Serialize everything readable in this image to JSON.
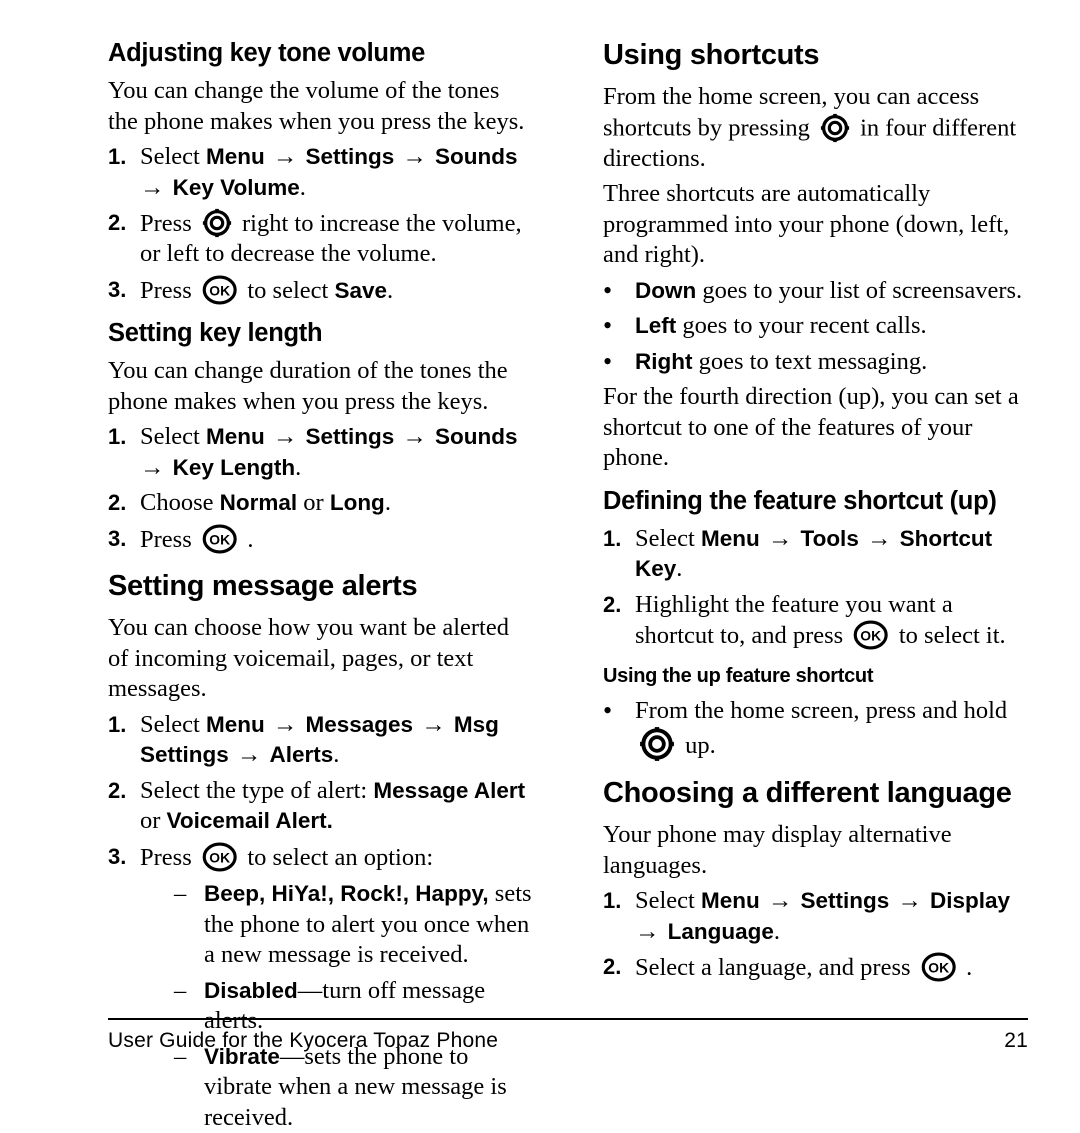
{
  "document": {
    "title": "User Guide for the Kyocera Topaz Phone",
    "page_number": "21"
  },
  "icons": {
    "nav_key": "navigation-key-icon",
    "ok_key": "ok-key-icon",
    "ok_label": "OK"
  },
  "arrow": "→",
  "bullet": "•",
  "dash": "–",
  "left_column": {
    "section1": {
      "heading": "Adjusting key tone volume",
      "intro": "You can change the volume of the tones the phone makes when you press the keys.",
      "steps": [
        {
          "marker": "1.",
          "parts": [
            {
              "t": "Select ",
              "s": "normal"
            },
            {
              "t": "Menu",
              "s": "bold"
            },
            {
              "t": " → ",
              "s": "arrow"
            },
            {
              "t": "Settings",
              "s": "bold"
            },
            {
              "t": " → ",
              "s": "arrow"
            },
            {
              "t": "Sounds",
              "s": "bold"
            },
            {
              "t": " → ",
              "s": "arrow"
            },
            {
              "t": "Key Volume",
              "s": "bold"
            },
            {
              "t": ".",
              "s": "normal"
            }
          ]
        },
        {
          "marker": "2.",
          "parts": [
            {
              "t": "Press ",
              "s": "normal"
            },
            {
              "t": "",
              "s": "nav-key"
            },
            {
              "t": " right to increase the volume, or left to decrease the volume.",
              "s": "normal"
            }
          ]
        },
        {
          "marker": "3.",
          "parts": [
            {
              "t": "Press ",
              "s": "normal"
            },
            {
              "t": "",
              "s": "ok-key"
            },
            {
              "t": " to select ",
              "s": "normal"
            },
            {
              "t": "Save",
              "s": "bold"
            },
            {
              "t": ".",
              "s": "normal"
            }
          ]
        }
      ]
    },
    "section2": {
      "heading": "Setting key length",
      "intro": "You can change duration of the tones the phone makes when you press the keys.",
      "steps": [
        {
          "marker": "1.",
          "parts": [
            {
              "t": "Select ",
              "s": "normal"
            },
            {
              "t": "Menu",
              "s": "bold"
            },
            {
              "t": " → ",
              "s": "arrow"
            },
            {
              "t": "Settings",
              "s": "bold"
            },
            {
              "t": " → ",
              "s": "arrow"
            },
            {
              "t": "Sounds",
              "s": "bold"
            },
            {
              "t": " → ",
              "s": "arrow"
            },
            {
              "t": "Key Length",
              "s": "bold"
            },
            {
              "t": ".",
              "s": "normal"
            }
          ]
        },
        {
          "marker": "2.",
          "parts": [
            {
              "t": "Choose ",
              "s": "normal"
            },
            {
              "t": "Normal",
              "s": "bold"
            },
            {
              "t": " or ",
              "s": "normal"
            },
            {
              "t": "Long",
              "s": "bold"
            },
            {
              "t": ".",
              "s": "normal"
            }
          ]
        },
        {
          "marker": "3.",
          "parts": [
            {
              "t": "Press ",
              "s": "normal"
            },
            {
              "t": "",
              "s": "ok-key"
            },
            {
              "t": " .",
              "s": "normal"
            }
          ]
        }
      ]
    },
    "section3": {
      "heading": "Setting message alerts",
      "intro": "You can choose how you want be alerted of incoming voicemail, pages, or text messages.",
      "steps": [
        {
          "marker": "1.",
          "parts": [
            {
              "t": "Select ",
              "s": "normal"
            },
            {
              "t": "Menu",
              "s": "bold"
            },
            {
              "t": " → ",
              "s": "arrow"
            },
            {
              "t": "Messages",
              "s": "bold"
            },
            {
              "t": " → ",
              "s": "arrow"
            },
            {
              "t": "Msg Settings",
              "s": "bold"
            },
            {
              "t": " → ",
              "s": "arrow"
            },
            {
              "t": "Alerts",
              "s": "bold"
            },
            {
              "t": ".",
              "s": "normal"
            }
          ]
        },
        {
          "marker": "2.",
          "parts": [
            {
              "t": "Select the type of alert: ",
              "s": "normal"
            },
            {
              "t": "Message Alert",
              "s": "bold"
            },
            {
              "t": " or ",
              "s": "normal"
            },
            {
              "t": "Voicemail Alert.",
              "s": "bold"
            }
          ]
        },
        {
          "marker": "3.",
          "parts": [
            {
              "t": "Press ",
              "s": "normal"
            },
            {
              "t": "",
              "s": "ok-key"
            },
            {
              "t": " to select an option:",
              "s": "normal"
            }
          ],
          "sublist": [
            {
              "marker": "–",
              "parts": [
                {
                  "t": "Beep, HiYa!, Rock!, Happy,",
                  "s": "bold"
                },
                {
                  "t": " sets the phone to alert you once when a new message is received.",
                  "s": "normal"
                }
              ]
            },
            {
              "marker": "–",
              "parts": [
                {
                  "t": "Disabled",
                  "s": "bold"
                },
                {
                  "t": "—turn off message alerts.",
                  "s": "normal"
                }
              ]
            },
            {
              "marker": "–",
              "parts": [
                {
                  "t": "Vibrate",
                  "s": "bold"
                },
                {
                  "t": "—sets the phone to vibrate when a new message is received.",
                  "s": "normal"
                }
              ]
            }
          ]
        }
      ]
    }
  },
  "right_column": {
    "section1": {
      "heading": "Using shortcuts",
      "paragraphs": [
        [
          {
            "t": "From the home screen, you can access shortcuts by pressing ",
            "s": "normal"
          },
          {
            "t": "",
            "s": "nav-key"
          },
          {
            "t": " in four different directions.",
            "s": "normal"
          }
        ],
        [
          {
            "t": "Three shortcuts are automatically programmed into your phone (down, left, and right).",
            "s": "normal"
          }
        ]
      ],
      "bullets": [
        {
          "marker": "•",
          "parts": [
            {
              "t": "Down",
              "s": "bold"
            },
            {
              "t": " goes to your list of screensavers.",
              "s": "normal"
            }
          ]
        },
        {
          "marker": "•",
          "parts": [
            {
              "t": "Left",
              "s": "bold"
            },
            {
              "t": " goes to your recent calls.",
              "s": "normal"
            }
          ]
        },
        {
          "marker": "•",
          "parts": [
            {
              "t": "Right",
              "s": "bold"
            },
            {
              "t": " goes to text messaging.",
              "s": "normal"
            }
          ]
        }
      ],
      "closing": "For the fourth direction (up), you can set a shortcut to one of the features of your phone."
    },
    "section2": {
      "heading": "Defining the feature shortcut (up)",
      "steps": [
        {
          "marker": "1.",
          "parts": [
            {
              "t": "Select ",
              "s": "normal"
            },
            {
              "t": "Menu",
              "s": "bold"
            },
            {
              "t": " → ",
              "s": "arrow"
            },
            {
              "t": "Tools",
              "s": "bold"
            },
            {
              "t": " → ",
              "s": "arrow"
            },
            {
              "t": "Shortcut Key",
              "s": "bold"
            },
            {
              "t": ".",
              "s": "normal"
            }
          ]
        },
        {
          "marker": "2.",
          "parts": [
            {
              "t": "Highlight the feature you want a shortcut to, and press ",
              "s": "normal"
            },
            {
              "t": "",
              "s": "ok-key"
            },
            {
              "t": " to select it.",
              "s": "normal"
            }
          ]
        }
      ],
      "subheading": "Using the up feature shortcut",
      "subbullets": [
        {
          "marker": "•",
          "parts": [
            {
              "t": "From the home screen, press and hold ",
              "s": "normal"
            },
            {
              "t": "",
              "s": "nav-key-lg"
            },
            {
              "t": " up.",
              "s": "normal"
            }
          ]
        }
      ]
    },
    "section3": {
      "heading": "Choosing a different language",
      "intro": "Your phone may display alternative languages.",
      "steps": [
        {
          "marker": "1.",
          "parts": [
            {
              "t": "Select ",
              "s": "normal"
            },
            {
              "t": "Menu",
              "s": "bold"
            },
            {
              "t": " → ",
              "s": "arrow"
            },
            {
              "t": "Settings",
              "s": "bold"
            },
            {
              "t": " → ",
              "s": "arrow"
            },
            {
              "t": "Display",
              "s": "bold"
            },
            {
              "t": " → ",
              "s": "arrow"
            },
            {
              "t": "Language",
              "s": "bold"
            },
            {
              "t": ".",
              "s": "normal"
            }
          ]
        },
        {
          "marker": "2.",
          "parts": [
            {
              "t": "Select a language, and press ",
              "s": "normal"
            },
            {
              "t": "",
              "s": "ok-key"
            },
            {
              "t": " .",
              "s": "normal"
            }
          ]
        }
      ]
    }
  }
}
